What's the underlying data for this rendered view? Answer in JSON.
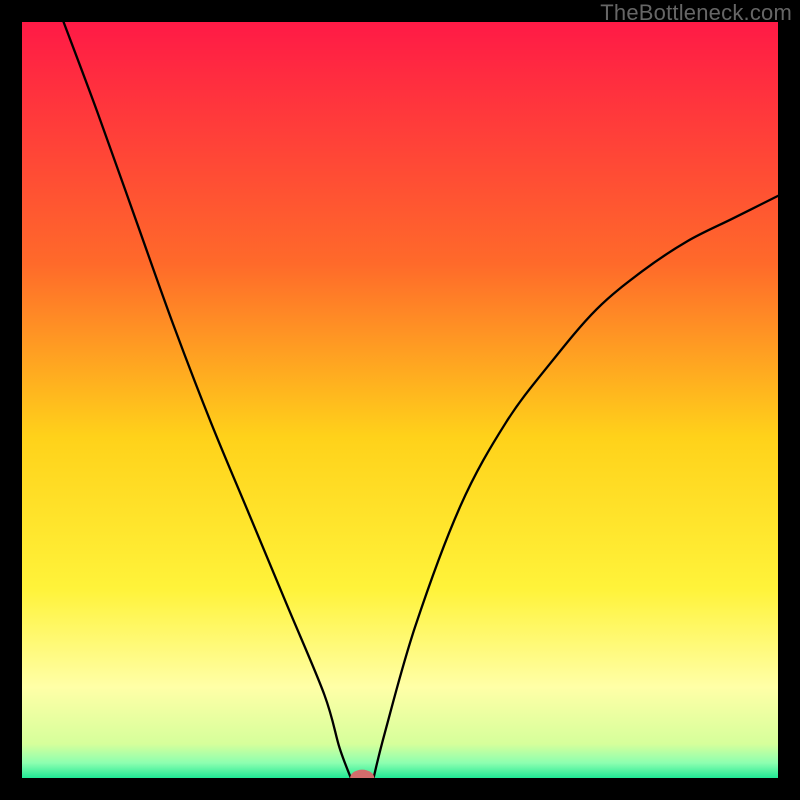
{
  "watermark": "TheBottleneck.com",
  "chart_data": {
    "type": "line",
    "title": "",
    "xlabel": "",
    "ylabel": "",
    "xlim": [
      0,
      100
    ],
    "ylim": [
      0,
      100
    ],
    "grid": false,
    "legend": false,
    "gradient_stops": [
      {
        "offset": 0.0,
        "color": "#ff1a46"
      },
      {
        "offset": 0.32,
        "color": "#ff6a2a"
      },
      {
        "offset": 0.55,
        "color": "#ffd21a"
      },
      {
        "offset": 0.75,
        "color": "#fff33a"
      },
      {
        "offset": 0.88,
        "color": "#ffffa7"
      },
      {
        "offset": 0.955,
        "color": "#d6ff9b"
      },
      {
        "offset": 0.98,
        "color": "#8dffb0"
      },
      {
        "offset": 1.0,
        "color": "#20e895"
      }
    ],
    "curve_left": {
      "x": [
        5.5,
        10,
        15,
        20,
        25,
        30,
        35,
        40,
        42,
        43.5
      ],
      "y": [
        100,
        88,
        74,
        60,
        47,
        35,
        23,
        11,
        4,
        0
      ]
    },
    "curve_right": {
      "x": [
        46.5,
        48,
        52,
        58,
        64,
        70,
        76,
        82,
        88,
        94,
        100
      ],
      "y": [
        0,
        6,
        20,
        36,
        47,
        55,
        62,
        67,
        71,
        74,
        77
      ]
    },
    "marker": {
      "x": 45.0,
      "y": 0.0,
      "rx": 1.6,
      "ry": 1.1,
      "color": "#d26c6c"
    }
  }
}
